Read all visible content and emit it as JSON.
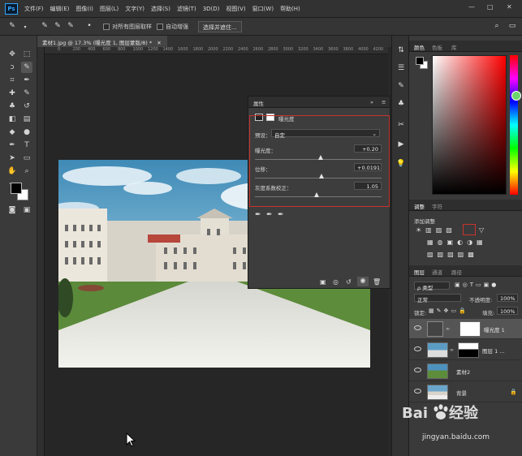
{
  "app": {
    "logo": "Ps"
  },
  "menu": [
    "文件(F)",
    "编辑(E)",
    "图像(I)",
    "图层(L)",
    "文字(Y)",
    "选择(S)",
    "滤镜(T)",
    "3D(D)",
    "视图(V)",
    "窗口(W)",
    "帮助(H)"
  ],
  "window_controls": {
    "minimize": "—",
    "maximize": "□",
    "close": "✕"
  },
  "options_bar": {
    "sample_all_layers": "对所有图层取样",
    "auto_enhance": "自动增强",
    "select_and_mask": "选择并遮住..."
  },
  "document": {
    "tab_title": "素材1.jpg @ 17.3% (曝光度 1, 图层蒙版/8) *",
    "tab_close": "✕",
    "ruler_ticks": [
      "0",
      "200",
      "400",
      "600",
      "800",
      "1000",
      "1200",
      "1400",
      "1600",
      "1800",
      "2000",
      "2200",
      "2400",
      "2600",
      "2800",
      "3000",
      "3200",
      "3400",
      "3600",
      "3800",
      "4000",
      "4200"
    ]
  },
  "properties_panel": {
    "tab_label": "属性",
    "collapse": "»",
    "menu": "≡",
    "adjustment_name": "曝光度",
    "preset_label": "预设：",
    "preset_value": "自定",
    "exposure_label": "曝光度：",
    "exposure_value": "+0.20",
    "exposure_level": 0.52,
    "offset_label": "位移：",
    "offset_value": "+0.0191",
    "offset_level": 0.53,
    "gamma_label": "灰度系数校正：",
    "gamma_value": "1.05",
    "gamma_level": 0.49
  },
  "color_panel": {
    "tabs": [
      "颜色",
      "色板",
      "库"
    ],
    "hue_accent": "#ff0000"
  },
  "adjustments_panel": {
    "tabs": [
      "调整",
      "字符"
    ],
    "add_label": "添加调整"
  },
  "layers_panel": {
    "tabs": [
      "图层",
      "通道",
      "路径"
    ],
    "kind_label": "ρ 类型",
    "blend_mode": "正常",
    "opacity_label": "不透明度:",
    "opacity_value": "100%",
    "lock_label": "锁定:",
    "fill_label": "填充:",
    "fill_value": "100%",
    "layers": [
      {
        "name": "曝光度 1",
        "type": "adjustment",
        "selected": true
      },
      {
        "name": "图层 1 ...",
        "type": "masked",
        "selected": false
      },
      {
        "name": "素材2",
        "type": "smart",
        "selected": false
      },
      {
        "name": "背景",
        "type": "background",
        "selected": false
      }
    ]
  },
  "watermark": {
    "brand": "Bai",
    "brand_suffix": "经验",
    "url": "jingyan.baidu.com"
  }
}
